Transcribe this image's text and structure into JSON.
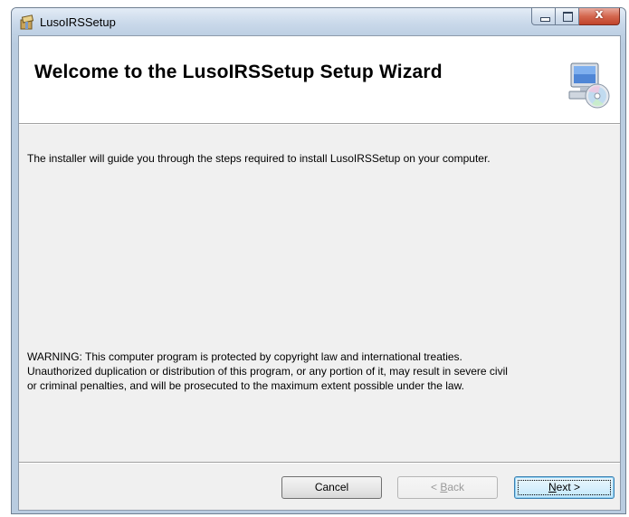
{
  "window": {
    "title": "LusoIRSSetup",
    "close_glyph": "x"
  },
  "banner": {
    "title": "Welcome to the LusoIRSSetup Setup Wizard",
    "art_icon": "computer-cd-icon"
  },
  "body": {
    "intro": "The installer will guide you through the steps required to install LusoIRSSetup on your computer.",
    "warning_lines": [
      "WARNING: This computer program is protected by copyright law and international treaties.",
      "Unauthorized duplication or distribution of this program, or any portion of it, may result in severe civil",
      "or criminal penalties, and will be prosecuted to the maximum extent possible under the law."
    ]
  },
  "buttons": {
    "cancel": "Cancel",
    "back_prefix": "< ",
    "back_accel": "B",
    "back_rest": "ack",
    "next_accel": "N",
    "next_rest": "ext >"
  },
  "colors": {
    "client_bg": "#f0f0f0",
    "next_border": "#3c7fb1",
    "close_red": "#c0432a"
  }
}
